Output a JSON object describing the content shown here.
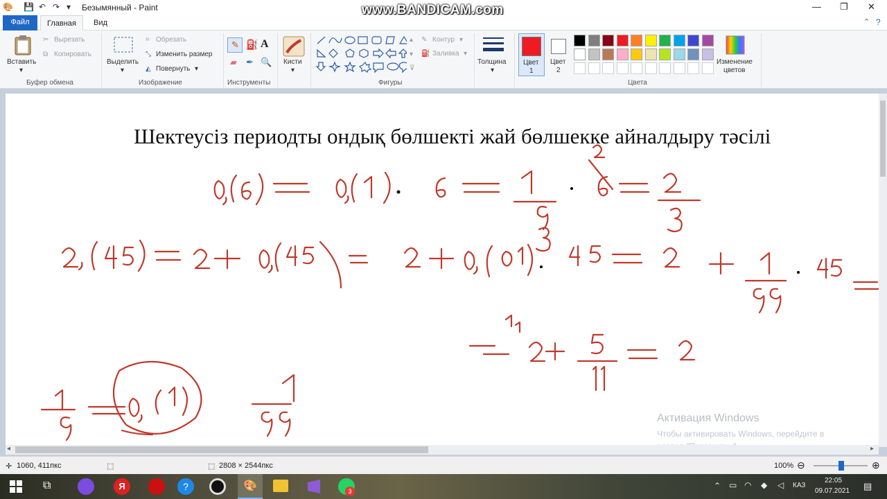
{
  "window": {
    "title": "Безымянный - Paint",
    "overlay": "www.BANDICAM.com"
  },
  "tabs": {
    "file": "Файл",
    "home": "Главная",
    "view": "Вид"
  },
  "ribbon": {
    "clipboard": {
      "paste": "Вставить",
      "cut": "Вырезать",
      "copy": "Копировать",
      "group": "Буфер обмена"
    },
    "image": {
      "select": "Выделить",
      "crop": "Обрезать",
      "resize": "Изменить размер",
      "rotate": "Повернуть",
      "group": "Изображение"
    },
    "tools": {
      "group": "Инструменты"
    },
    "brushes": "Кисти",
    "shapes": {
      "outline": "Контур",
      "fill": "Заливка",
      "group": "Фигуры"
    },
    "size": "Толщина",
    "color1": {
      "label": "Цвет",
      "num": "1"
    },
    "color2": {
      "label": "Цвет",
      "num": "2"
    },
    "colors_group": "Цвета",
    "edit_colors": {
      "line1": "Изменение",
      "line2": "цветов"
    },
    "palette_row1": [
      "#000000",
      "#7f7f7f",
      "#880015",
      "#ed1c24",
      "#ff7f27",
      "#fff200",
      "#22b14c",
      "#00a2e8",
      "#3f48cc",
      "#a349a4"
    ],
    "palette_row2": [
      "#ffffff",
      "#c3c3c3",
      "#b97a57",
      "#ffaec9",
      "#ffc90e",
      "#efe4b0",
      "#b5e61d",
      "#99d9ea",
      "#7092be",
      "#c8bfe7"
    ],
    "color1_value": "#ed1c24",
    "color2_value": "#ffffff"
  },
  "canvas": {
    "heading": "Шектеусіз периодты ондық бөлшекті жай бөлшекке айналдыру тәсілі",
    "ink_color": "#c0392b"
  },
  "watermark": {
    "line1": "Активация Windows",
    "line2": "Чтобы активировать Windows, перейдите в",
    "line3": "раздел \"Параметры\"."
  },
  "status": {
    "cursor": "1060, 411пкс",
    "size": "2808 × 2544пкс",
    "zoom": "100%"
  },
  "taskbar": {
    "lang": "КАЗ",
    "time": "22:05",
    "date": "09.07.2021",
    "badge": "3"
  }
}
